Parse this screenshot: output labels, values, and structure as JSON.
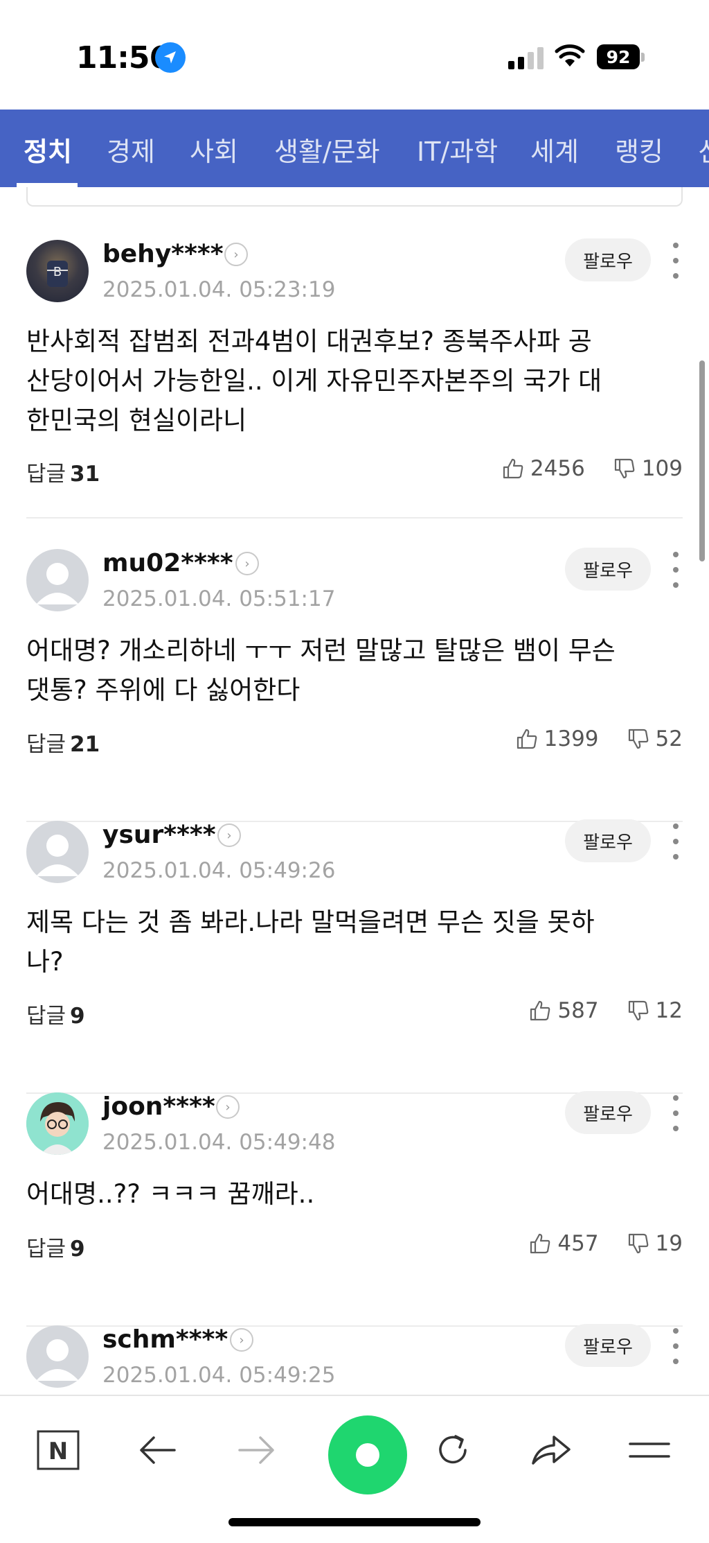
{
  "status": {
    "time": "11:56",
    "battery": "92"
  },
  "nav": {
    "items": [
      "정치",
      "경제",
      "사회",
      "생활/문화",
      "IT/과학",
      "세계",
      "랭킹",
      "신"
    ]
  },
  "comments": [
    {
      "user": "behy****",
      "time": "2025.01.04. 05:23:19",
      "follow": "팔로우",
      "lines": [
        "반사회적 잡범죄 전과4범이 대권후보? 종북주사파 공",
        "산당이어서 가능한일.. 이게 자유민주자본주의 국가 대",
        "한민국의 현실이라니"
      ],
      "reply_label": "답글",
      "reply_count": "31",
      "likes": "2456",
      "dislikes": "109"
    },
    {
      "user": "mu02****",
      "time": "2025.01.04. 05:51:17",
      "follow": "팔로우",
      "lines": [
        "어대명? 개소리하네 ㅜㅜ 저런 말많고 탈많은 뱀이 무슨",
        "댓통? 주위에 다 싫어한다"
      ],
      "reply_label": "답글",
      "reply_count": "21",
      "likes": "1399",
      "dislikes": "52"
    },
    {
      "user": "ysur****",
      "time": "2025.01.04. 05:49:26",
      "follow": "팔로우",
      "lines": [
        "제목 다는 것 좀 봐라.나라 말먹을려면 무슨 짓을 못하",
        "나?"
      ],
      "reply_label": "답글",
      "reply_count": "9",
      "likes": "587",
      "dislikes": "12"
    },
    {
      "user": "joon****",
      "time": "2025.01.04. 05:49:48",
      "follow": "팔로우",
      "lines": [
        "어대명..?? ㅋㅋㅋ 꿈깨라.."
      ],
      "reply_label": "답글",
      "reply_count": "9",
      "likes": "457",
      "dislikes": "19"
    },
    {
      "user": "schm****",
      "time": "2025.01.04. 05:49:25",
      "follow": "팔로우",
      "lines": [],
      "reply_label": "",
      "reply_count": "",
      "likes": "",
      "dislikes": ""
    }
  ],
  "toolbar": {
    "home_letter": "N"
  },
  "colors": {
    "nav_bg": "#4663c4",
    "accent_green": "#1fd66f"
  }
}
